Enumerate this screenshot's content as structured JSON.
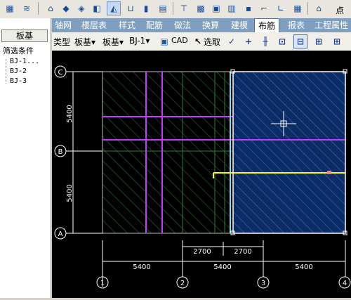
{
  "toolbar": {
    "icons": [
      "grid-icon",
      "layers-icon",
      "beam-icon",
      "wall-icon",
      "column-icon",
      "slab-icon",
      "foundation-icon",
      "stair-icon",
      "pile-icon",
      "rebar-icon",
      "u-beam-icon",
      "post-icon",
      "brick-icon",
      "opening-icon",
      "board-icon",
      "save-icon",
      "corner-icon",
      "l-shape-icon",
      "house-icon"
    ],
    "point_label": "点"
  },
  "left_panel": {
    "slab_tab": "板基",
    "filter_label": "筛选条件",
    "tree_items": [
      "BJ-1...",
      "BJ-2",
      "BJ-3"
    ]
  },
  "tabs": [
    "轴网",
    "楼层表",
    "样式",
    "配筋",
    "做法",
    "换算",
    "建模",
    "布筋",
    "报表",
    "工程属性"
  ],
  "active_tab_index": 7,
  "toolbar2": {
    "type_label": "类型",
    "type_value": "板基",
    "sub_value": "板基",
    "id_value": "BJ-1",
    "cad_label": "CAD",
    "select_label": "选取"
  },
  "drawing": {
    "axis_letters": [
      "C",
      "B",
      "A"
    ],
    "axis_numbers": [
      "1",
      "2",
      "3",
      "4"
    ],
    "left_dims": [
      "5400",
      "5400"
    ],
    "bottom_dims": [
      "5400",
      "5400",
      "5400"
    ],
    "sub_dims": [
      "2700",
      "2700"
    ],
    "colors": {
      "hatch_left": "#2e7d3a",
      "hatch_right": "#1f58b5",
      "magenta": "#c03cff",
      "yellow": "#ffff00",
      "cyan": "#7fe3ff"
    }
  }
}
